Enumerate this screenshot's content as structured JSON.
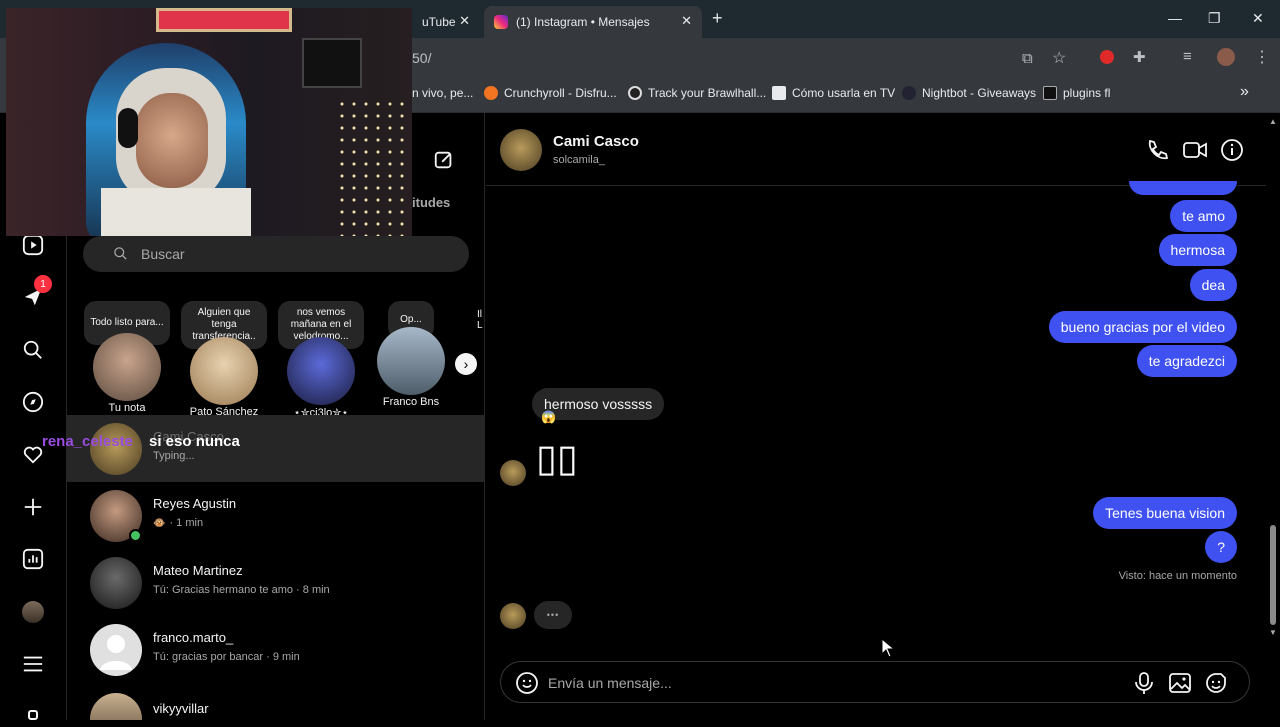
{
  "browser": {
    "tabs": [
      {
        "label": "uTube",
        "active": false
      },
      {
        "label": "(1) Instagram • Mensajes",
        "active": true
      }
    ],
    "new_tab_label": "+",
    "url": "50/",
    "bookmarks": [
      {
        "label": "n vivo, pe...",
        "icon": "page-icon"
      },
      {
        "label": "Crunchyroll - Disfru...",
        "icon": "crunchyroll-icon",
        "color": "#f47521"
      },
      {
        "label": "Track your Brawlhall...",
        "icon": "brawlhalla-icon"
      },
      {
        "label": "Cómo usarla en TV",
        "icon": "page-icon"
      },
      {
        "label": "Nightbot - Giveaways",
        "icon": "nightbot-icon"
      },
      {
        "label": "plugins fl",
        "icon": "folder-icon"
      }
    ],
    "more_bookmarks": "»"
  },
  "sidebar_rail": {
    "notification_badge": "1",
    "items": [
      "reels-icon",
      "messages-icon",
      "search-icon",
      "explore-icon",
      "heart-icon",
      "create-icon",
      "insights-icon",
      "profile-icon",
      "menu-icon",
      "threads-icon"
    ]
  },
  "list": {
    "header_partial": "itudes",
    "search_placeholder": "Buscar",
    "notes": [
      {
        "text": "Todo listo para...",
        "name": "Tu nota"
      },
      {
        "text": "Alguien que tenga transferencia..",
        "name": "Pato Sánchez"
      },
      {
        "text": "nos vemos mañana en el velodromo...",
        "name": "⋆✮ci3lo✮⋆"
      },
      {
        "text": "Op...",
        "name": "Franco Bns"
      }
    ],
    "notes_partial": "Il L",
    "conversations": [
      {
        "name": "Cami Casco",
        "meta": "Typing..."
      },
      {
        "name": "Reyes Agustin",
        "meta": "· 1 min"
      },
      {
        "name": "Mateo Martinez",
        "meta": "Tú: Gracias hermano te amo · 8 min"
      },
      {
        "name": "franco.marto_",
        "meta": "Tú: gracias por bancar · 9 min"
      },
      {
        "name": "vikyyvillar",
        "meta": ""
      }
    ]
  },
  "chat": {
    "name": "Cami Casco",
    "username": "solcamila_",
    "messages_out": [
      "te amo",
      "hermosa",
      "dea",
      "bueno gracias por el video",
      "te agradezci",
      "Tenes buena vision",
      "?"
    ],
    "message_in": "hermoso vosssss",
    "reaction": "😱",
    "boxes_text": "▯▯",
    "seen": "Visto: hace un momento",
    "typing_dots": "•••",
    "composer_placeholder": "Envía un mensaje..."
  },
  "stream_overlay": {
    "username": "rena_celeste",
    "message": "si eso nunca"
  },
  "colors": {
    "accent_bubble": "#3f51f0",
    "badge": "#ff3040",
    "online": "#44c262",
    "overlay_name": "#9a4de0"
  }
}
